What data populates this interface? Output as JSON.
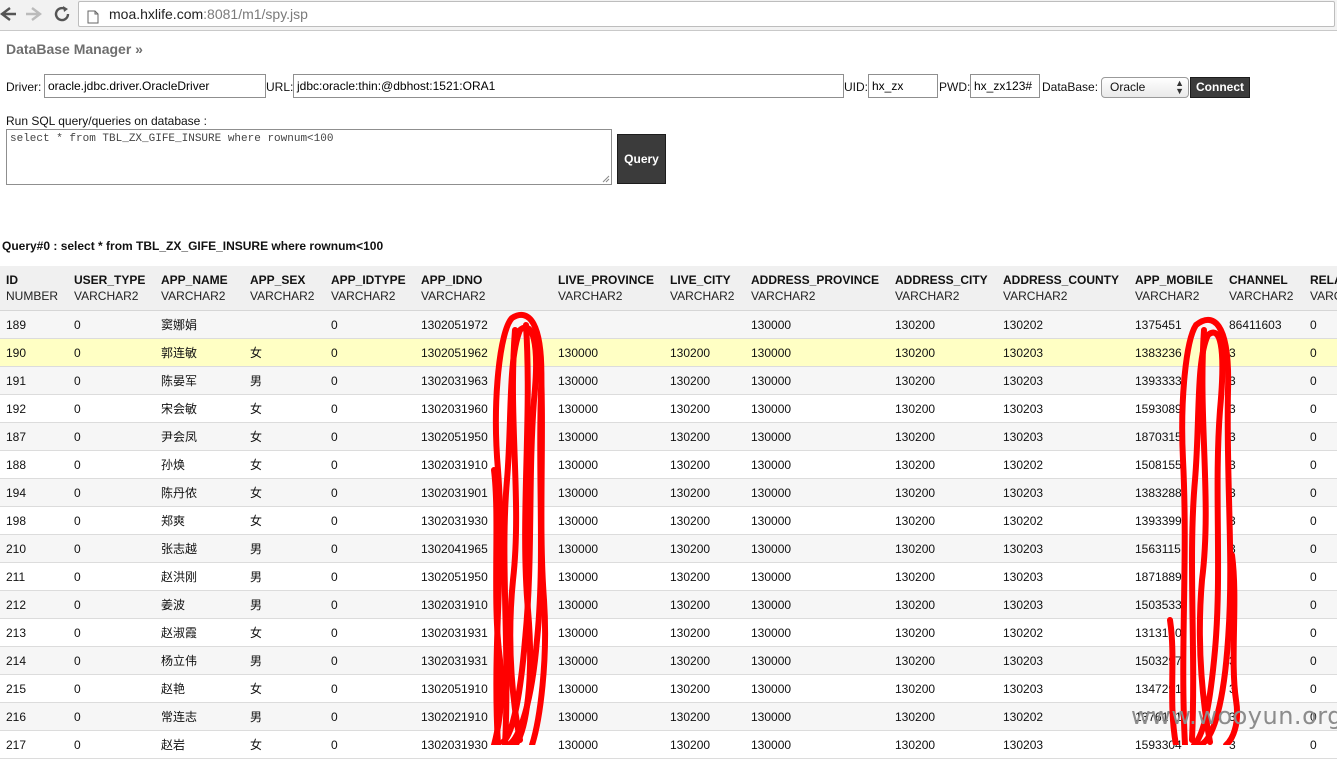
{
  "browser": {
    "url_host": "moa.hxlife.com",
    "url_path": ":8081/m1/spy.jsp"
  },
  "app": {
    "title": "DataBase Manager »"
  },
  "connection": {
    "driver_label": "Driver:",
    "driver_value": "oracle.jdbc.driver.OracleDriver",
    "url_label": "URL:",
    "url_value": "jdbc:oracle:thin:@dbhost:1521:ORA1",
    "uid_label": "UID:",
    "uid_value": "hx_zx",
    "pwd_label": "PWD:",
    "pwd_value": "hx_zx123#",
    "database_label": "DataBase:",
    "database_selected": "Oracle",
    "connect_label": "Connect"
  },
  "query": {
    "prompt": "Run SQL query/queries on database :",
    "sql": "select * from TBL_ZX_GIFE_INSURE where rownum<100",
    "button_label": "Query"
  },
  "results": {
    "heading": "Query#0 : select * from TBL_ZX_GIFE_INSURE where rownum<100",
    "columns": [
      {
        "name": "ID",
        "type": "NUMBER"
      },
      {
        "name": "USER_TYPE",
        "type": "VARCHAR2"
      },
      {
        "name": "APP_NAME",
        "type": "VARCHAR2"
      },
      {
        "name": "APP_SEX",
        "type": "VARCHAR2"
      },
      {
        "name": "APP_IDTYPE",
        "type": "VARCHAR2"
      },
      {
        "name": "APP_IDNO",
        "type": "VARCHAR2"
      },
      {
        "name": "LIVE_PROVINCE",
        "type": "VARCHAR2"
      },
      {
        "name": "LIVE_CITY",
        "type": "VARCHAR2"
      },
      {
        "name": "ADDRESS_PROVINCE",
        "type": "VARCHAR2"
      },
      {
        "name": "ADDRESS_CITY",
        "type": "VARCHAR2"
      },
      {
        "name": "ADDRESS_COUNTY",
        "type": "VARCHAR2"
      },
      {
        "name": "APP_MOBILE",
        "type": "VARCHAR2"
      },
      {
        "name": "CHANNEL",
        "type": "VARCHAR2"
      },
      {
        "name": "RELA",
        "type": "VARC"
      }
    ],
    "highlighted_row": 1,
    "rows": [
      [
        "189",
        "0",
        "窦娜娟",
        "",
        "0",
        "1302051972",
        "",
        "",
        "130000",
        "130200",
        "130202",
        "1375451",
        "86411603",
        "0"
      ],
      [
        "190",
        "0",
        "郭连敏",
        "女",
        "0",
        "1302051962",
        "130000",
        "130200",
        "130000",
        "130200",
        "130203",
        "1383236",
        "3",
        "0"
      ],
      [
        "191",
        "0",
        "陈晏军",
        "男",
        "0",
        "1302031963",
        "130000",
        "130200",
        "130000",
        "130200",
        "130203",
        "1393333",
        "3",
        "0"
      ],
      [
        "192",
        "0",
        "宋会敏",
        "女",
        "0",
        "1302031960",
        "130000",
        "130200",
        "130000",
        "130200",
        "130203",
        "1593089",
        "3",
        "0"
      ],
      [
        "187",
        "0",
        "尹会凤",
        "女",
        "0",
        "1302051950",
        "130000",
        "130200",
        "130000",
        "130200",
        "130203",
        "1870315",
        "3",
        "0"
      ],
      [
        "188",
        "0",
        "孙焕",
        "女",
        "0",
        "1302031910",
        "130000",
        "130200",
        "130000",
        "130200",
        "130202",
        "1508155",
        "3",
        "0"
      ],
      [
        "194",
        "0",
        "陈丹侬",
        "女",
        "0",
        "1302031901",
        "130000",
        "130200",
        "130000",
        "130200",
        "130203",
        "1383288",
        "3",
        "0"
      ],
      [
        "198",
        "0",
        "郑爽",
        "女",
        "0",
        "1302031930",
        "130000",
        "130200",
        "130000",
        "130200",
        "130202",
        "1393399",
        "3",
        "0"
      ],
      [
        "210",
        "0",
        "张志越",
        "男",
        "0",
        "1302041965",
        "130000",
        "130200",
        "130000",
        "130200",
        "130203",
        "1563115",
        "3",
        "0"
      ],
      [
        "211",
        "0",
        "赵洪刚",
        "男",
        "0",
        "1302051950",
        "130000",
        "130200",
        "130000",
        "130200",
        "130203",
        "1871889",
        "3",
        "0"
      ],
      [
        "212",
        "0",
        "姜波",
        "男",
        "0",
        "1302031910",
        "130000",
        "130200",
        "130000",
        "130200",
        "130203",
        "1503533",
        "3",
        "0"
      ],
      [
        "213",
        "0",
        "赵淑霞",
        "女",
        "0",
        "1302031931",
        "130000",
        "130200",
        "130000",
        "130200",
        "130202",
        "1313150",
        "3",
        "0"
      ],
      [
        "214",
        "0",
        "杨立伟",
        "男",
        "0",
        "1302031931",
        "130000",
        "130200",
        "130000",
        "130200",
        "130203",
        "1503297",
        "3",
        "0"
      ],
      [
        "215",
        "0",
        "赵艳",
        "女",
        "0",
        "1302051910",
        "130000",
        "130200",
        "130000",
        "130200",
        "130203",
        "1347291",
        "3",
        "0"
      ],
      [
        "216",
        "0",
        "常连志",
        "男",
        "0",
        "1302021910",
        "130000",
        "130200",
        "130000",
        "130200",
        "130202",
        "1376171",
        "3",
        "0"
      ],
      [
        "217",
        "0",
        "赵岩",
        "女",
        "0",
        "1302031930",
        "130000",
        "130200",
        "130000",
        "130200",
        "130203",
        "1593304",
        "3",
        "0"
      ]
    ]
  },
  "watermark": "www.wooyun.org",
  "colors": {
    "scribble": "#ff0000",
    "highlight_row": "#ffffc4",
    "button": "#3b3b3b"
  }
}
